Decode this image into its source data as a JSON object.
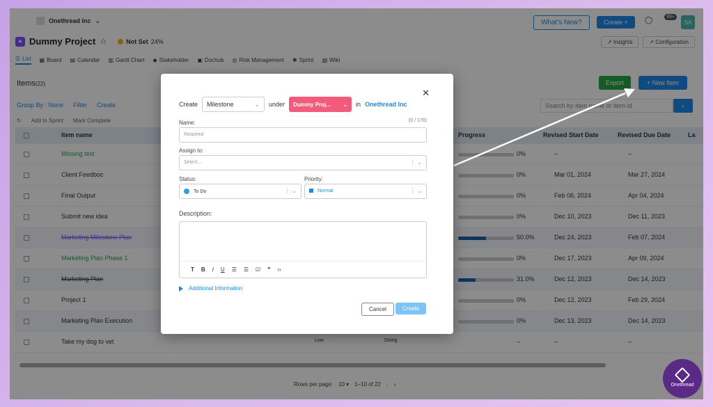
{
  "header": {
    "workspace": "Onethread Inc",
    "whats_new": "What's New?",
    "create": "Create +",
    "badge": "99+",
    "avatar": "SA"
  },
  "project": {
    "title": "Dummy Project",
    "status": "Not Set",
    "progress": "24%",
    "insights": "Insights",
    "configuration": "Configuration"
  },
  "tabs": [
    "List",
    "Board",
    "Calendar",
    "Gantt Chart",
    "Stakeholder",
    "Dochub",
    "Risk Management",
    "Sprint",
    "Wiki"
  ],
  "items": {
    "label": "Items",
    "count": "(22)",
    "export": "Export",
    "new_item": "+ New Item",
    "group_by": "Group By : None",
    "filter": "Filter",
    "create": "Create",
    "search_placeholder": "Search by item name or item id",
    "add_to_sprint": "Add to Sprint",
    "mark_complete": "Mark Complete"
  },
  "table": {
    "headers": {
      "item_name": "Item name",
      "progress": "Progress",
      "revised_start": "Revised Start Date",
      "revised_due": "Revised Due Date",
      "last": "La"
    },
    "rows": [
      {
        "name": "Missing text",
        "progress": "0%",
        "start": "–",
        "due": "–"
      },
      {
        "name": "Client Feedboc",
        "progress": "0%",
        "start": "Mar 01, 2024",
        "due": "Mar 27, 2024"
      },
      {
        "name": "Final Output",
        "progress": "0%",
        "start": "Feb 06, 2024",
        "due": "Apr 04, 2024"
      },
      {
        "name": "Submit new idea",
        "progress": "0%",
        "start": "Dec 10, 2023",
        "due": "Dec 11, 2023"
      },
      {
        "name": "Marketing Milestone Plan",
        "progress": "50.0%",
        "start": "Dec 24, 2023",
        "due": "Feb 07, 2024"
      },
      {
        "name": "Marketing Plan Phase 1",
        "progress": "0%",
        "start": "Dec 17, 2023",
        "due": "Apr 09, 2024"
      },
      {
        "name": "Marketing Plan",
        "progress": "31.0%",
        "start": "Dec 12, 2023",
        "due": "Dec 14, 2023"
      },
      {
        "name": "Project 1",
        "progress": "0%",
        "start": "Dec 12, 2023",
        "due": "Feb 29, 2024"
      },
      {
        "name": "Marketing Plan Execution",
        "progress": "0%",
        "start": "Dec 13, 2023",
        "due": "Dec 14, 2023"
      },
      {
        "name": "Take my dog to vet",
        "progress": "–",
        "start": "–",
        "due": "–",
        "priority": "Low",
        "status": "Doing"
      }
    ],
    "progress_fill": [
      0,
      0,
      0,
      0,
      0.5,
      0,
      0.31,
      0,
      0,
      0
    ]
  },
  "pager": {
    "rows_per_page": "Rows per page:",
    "size": "10",
    "range": "1–10 of 22"
  },
  "brand_badge": "Onethread",
  "modal": {
    "create_label": "Create",
    "type": "Milestone",
    "under_label": "under",
    "project": "Dummy Proj...",
    "in_label": "in",
    "workspace": "Onethread Inc",
    "name_label": "Name:",
    "name_count": "(0 / 170)",
    "name_placeholder": "Required",
    "assign_label": "Assign to:",
    "assign_placeholder": "Select...",
    "status_label": "Status:",
    "status_value": "To Do",
    "priority_label": "Priority:",
    "priority_value": "Normal",
    "description_label": "Description:",
    "additional": "Additional Information",
    "cancel": "Cancel",
    "create": "Create"
  },
  "colors": {
    "accent": "#1e88e5",
    "export": "#28a745",
    "project_chip": "#f25c7a"
  }
}
